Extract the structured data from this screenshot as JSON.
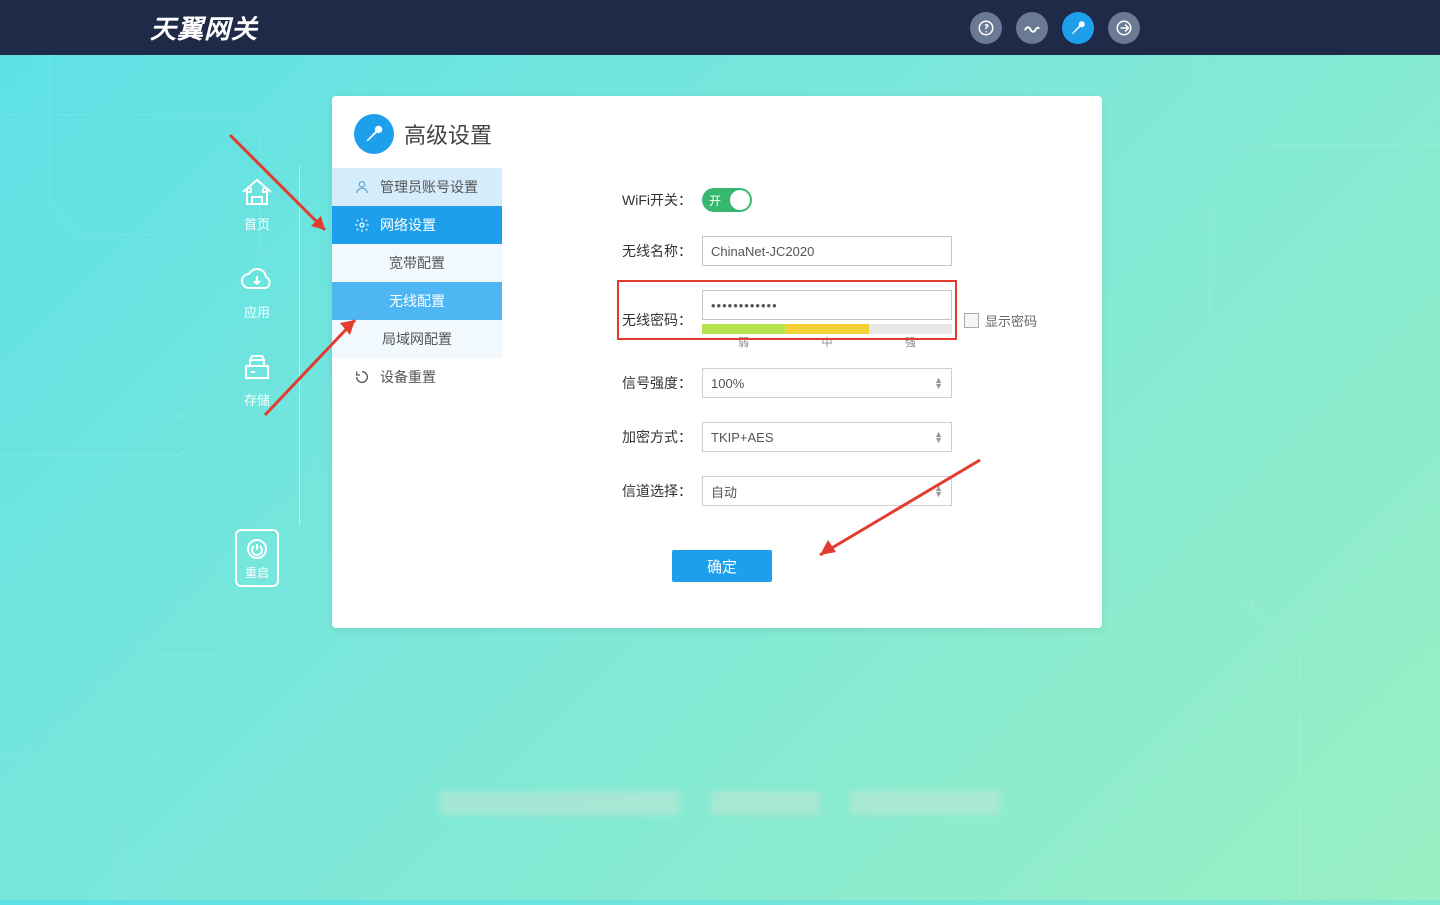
{
  "brand": "天翼网关",
  "pageTitle": "高级设置",
  "leftnav": {
    "home": "首页",
    "apps": "应用",
    "storage": "存储",
    "restart": "重启"
  },
  "sidemenu": {
    "admin": "管理员账号设置",
    "network": "网络设置",
    "broadband": "宽带配置",
    "wireless": "无线配置",
    "lan": "局域网配置",
    "reset": "设备重置"
  },
  "form": {
    "wifiSwitchLabel": "WiFi开关：",
    "wifiSwitchOn": "开",
    "nameLabel": "无线名称：",
    "nameValue": "ChinaNet-JC2020",
    "pwLabel": "无线密码：",
    "pwValue": "••••••••••••",
    "showPw": "显示密码",
    "strength": {
      "weak": "弱",
      "mid": "中",
      "strong": "强"
    },
    "signalLabel": "信号强度：",
    "signalValue": "100%",
    "encLabel": "加密方式：",
    "encValue": "TKIP+AES",
    "chanLabel": "信道选择：",
    "chanValue": "自动",
    "submit": "确定"
  }
}
